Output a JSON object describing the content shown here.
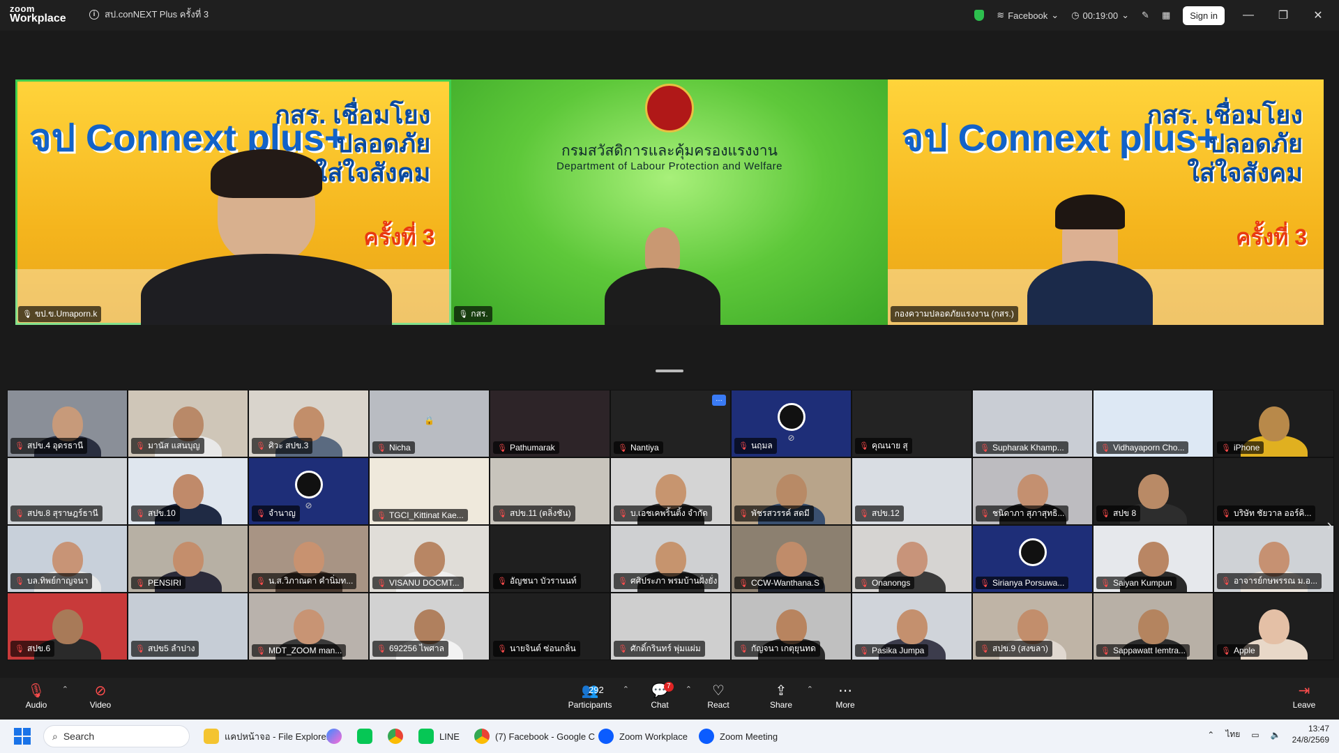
{
  "window": {
    "logo_line1": "zoom",
    "logo_line2": "Workplace",
    "meeting_title": "สป.conNEXT Plus ครั้งที่ 3",
    "live_stream": "Facebook",
    "timer": "00:19:00",
    "signin_label": "Sign in",
    "accent_green": "#3fcf4f"
  },
  "spotlight": [
    {
      "name": "ขป.ข.Umaporn.k",
      "poster_title": "จป Connext plus+",
      "poster_sub": "กสร. เชื่อมโยง\nปลอดภัย\nใส่ใจสังคม",
      "poster_round": "ครั้งที่ 3",
      "active": true
    },
    {
      "name": "กสร.",
      "org_th": "กรมสวัสดิการและคุ้มครองแรงงาน",
      "org_en": "Department of Labour Protection and Welfare"
    },
    {
      "name": "กองความปลอดภัยแรงงาน (กสร.)",
      "poster_title": "จป Connext plus+",
      "poster_sub": "กสร. เชื่อมโยง\nปลอดภัย\nใส่ใจสังคม",
      "poster_round": "ครั้งที่ 3"
    }
  ],
  "gallery": [
    {
      "name": "สปข.4 อุดรธานี",
      "bg": "#8a8f98",
      "skin": "#c79a7a",
      "shirt": "#2a2f40"
    },
    {
      "name": "มานัส แสนบุญ",
      "bg": "#cfc6b8",
      "skin": "#b98968",
      "shirt": "#e8e8e8"
    },
    {
      "name": "ศิวะ สปข.3",
      "bg": "#d9d4cc",
      "skin": "#c28e6a",
      "shirt": "#5a6a80"
    },
    {
      "name": "Nicha",
      "bg": "#b9bcc2",
      "logo": "lock",
      "skin": "",
      "shirt": ""
    },
    {
      "name": "Pathumarak",
      "bg": "#2d2428",
      "skin": "",
      "shirt": ""
    },
    {
      "name": "Nantiya",
      "bg": "#222222",
      "skin": "",
      "shirt": "",
      "more": true
    },
    {
      "name": "นฤมล",
      "bg": "#1e2e78",
      "logo": "obs",
      "cam_off": true
    },
    {
      "name": "คุณนาย สุ",
      "bg": "#232323"
    },
    {
      "name": "Supharak Khamp...",
      "bg": "#c9cdd4",
      "skin": "",
      "shirt": ""
    },
    {
      "name": "Vidhayaporn Cho...",
      "bg": "#dde8f4",
      "skin": "",
      "shirt": ""
    },
    {
      "name": "iPhone",
      "bg": "#1d1d1d",
      "skin": "#b8894a",
      "shirt": "#e0b020"
    },
    {
      "name": "สปข.8 สุราษฎร์ธานี",
      "bg": "#d0d4d8",
      "skin": "",
      "shirt": ""
    },
    {
      "name": "สปข.10",
      "bg": "#dfe6ee",
      "skin": "#c08a6a",
      "shirt": "#1f2a44"
    },
    {
      "name": "จำนาญ",
      "bg": "#1e2e78",
      "logo": "obs",
      "cam_off": true
    },
    {
      "name": "TGCI_Kittinat Kae...",
      "bg": "#efe9dc",
      "skin": "",
      "shirt": ""
    },
    {
      "name": "สปข.11 (ตลิ่งชัน)",
      "bg": "#c8c4bc",
      "skin": "",
      "shirt": ""
    },
    {
      "name": "บ.เอชเคพริ้นติ้ง จำกัด",
      "bg": "#d4d4d4",
      "skin": "#c7956f",
      "shirt": "#2a2a2a"
    },
    {
      "name": "พัชรสวรรค์ สดมี",
      "bg": "#b8a48a",
      "skin": "#b88a66",
      "shirt": "#3a5070"
    },
    {
      "name": "สปข.12",
      "bg": "#d9dde3",
      "skin": "",
      "shirt": ""
    },
    {
      "name": "ชนิดาภา สุภาสุทธิ...",
      "bg": "#bdbcc0",
      "skin": "#c49070",
      "shirt": "#222"
    },
    {
      "name": "สปข 8",
      "bg": "#1f1f1f",
      "skin": "#b98a66",
      "shirt": "#2d2d2d"
    },
    {
      "name": "บริษัท ชัยวาล ออร์คิ...",
      "bg": "#1e1e1e",
      "skin": "",
      "shirt": ""
    },
    {
      "name": "บล.ทิพย์กาญจนา",
      "bg": "#c8d0da",
      "skin": "#c89476",
      "shirt": "#e8e8e8"
    },
    {
      "name": "PENSIRI",
      "bg": "#b7b0a4",
      "skin": "#c48e6c",
      "shirt": "#2b2b3a"
    },
    {
      "name": "น.ส.วิภาณดา คำนิ่มท...",
      "bg": "#a89484",
      "skin": "#c89270",
      "shirt": "#4a3a30"
    },
    {
      "name": "VISANU DOCMT...",
      "bg": "#e0ddd8",
      "skin": "#b88664",
      "shirt": "#f0f0f0"
    },
    {
      "name": "อัญชนา บัวรานนท์",
      "bg": "#1f1f1f"
    },
    {
      "name": "ศศิประภา พรมบ้านฝั่งยั่ง",
      "bg": "#cfd0d2",
      "skin": "#c6946e",
      "shirt": "#2c2c2c"
    },
    {
      "name": "CCW-Wanthana.S",
      "bg": "#8c8070",
      "skin": "#c08c6a",
      "shirt": "#1f2430"
    },
    {
      "name": "Onanongs",
      "bg": "#d6d4d2",
      "skin": "#c8947a",
      "shirt": "#3a3a3a"
    },
    {
      "name": "Sirianya Porsuwa...",
      "bg": "#1e2e78",
      "logo": "obs",
      "cam_off": false
    },
    {
      "name": "Saiyan Kumpun",
      "bg": "#e6e8ec",
      "skin": "#b98664",
      "shirt": "#2a2a2a"
    },
    {
      "name": "อาจารย์กษพรรณ ม.อ...",
      "bg": "#cfd2d6",
      "skin": "#c69172",
      "shirt": "#ede6de"
    },
    {
      "name": "สปข.6",
      "bg": "#c83a3a",
      "skin": "#a87a58",
      "shirt": "#2a2a2a"
    },
    {
      "name": "สปข5 ลำปาง",
      "bg": "#c6cdd6",
      "skin": "",
      "shirt": ""
    },
    {
      "name": "MDT_ZOOM man...",
      "bg": "#b9b2ac",
      "skin": "#c89474",
      "shirt": "#3a3a3a"
    },
    {
      "name": "692256 ไพศาล",
      "bg": "#d2d2d2",
      "skin": "#b0805e",
      "shirt": "#f2f2f2"
    },
    {
      "name": "นายจินต์ ซ่อนกลิ่น",
      "bg": "#1f1f1f"
    },
    {
      "name": "ศักดิ์กรินทร์ พุ่มแผ่ม",
      "bg": "#cfcfcf",
      "skin": "",
      "shirt": ""
    },
    {
      "name": "กัญจนา เกตุยุนทด",
      "bg": "#c0c0c0",
      "skin": "#b8845f",
      "shirt": "#2a2a2a"
    },
    {
      "name": "Pasika Jumpa",
      "bg": "#d0d4da",
      "skin": "#c4906e",
      "shirt": "#3c3c4c"
    },
    {
      "name": "สปข.9 (สงขลา)",
      "bg": "#bfb4a6",
      "skin": "#c28e6c",
      "shirt": "#e0d8d0"
    },
    {
      "name": "Sappawatt Iemtra...",
      "bg": "#b8b0a6",
      "skin": "#b4845f",
      "shirt": "#2d2d2d"
    },
    {
      "name": "Apple",
      "bg": "#1e1e1e",
      "skin": "#e4c0a6",
      "shirt": "#e8d8c8"
    }
  ],
  "toolbar": {
    "audio": "Audio",
    "video": "Video",
    "participants": "Participants",
    "participants_count": "292",
    "chat": "Chat",
    "chat_badge": "7",
    "react": "React",
    "share": "Share",
    "more": "More",
    "leave": "Leave"
  },
  "taskbar": {
    "search": "Search",
    "items": [
      "แคปหน้าจอ - File Explorer",
      "LINE",
      "(7) Facebook - Google C",
      "Zoom Workplace",
      "Zoom Meeting"
    ],
    "lang": "ไทย",
    "time": "13:47",
    "date": "24/8/2569"
  }
}
